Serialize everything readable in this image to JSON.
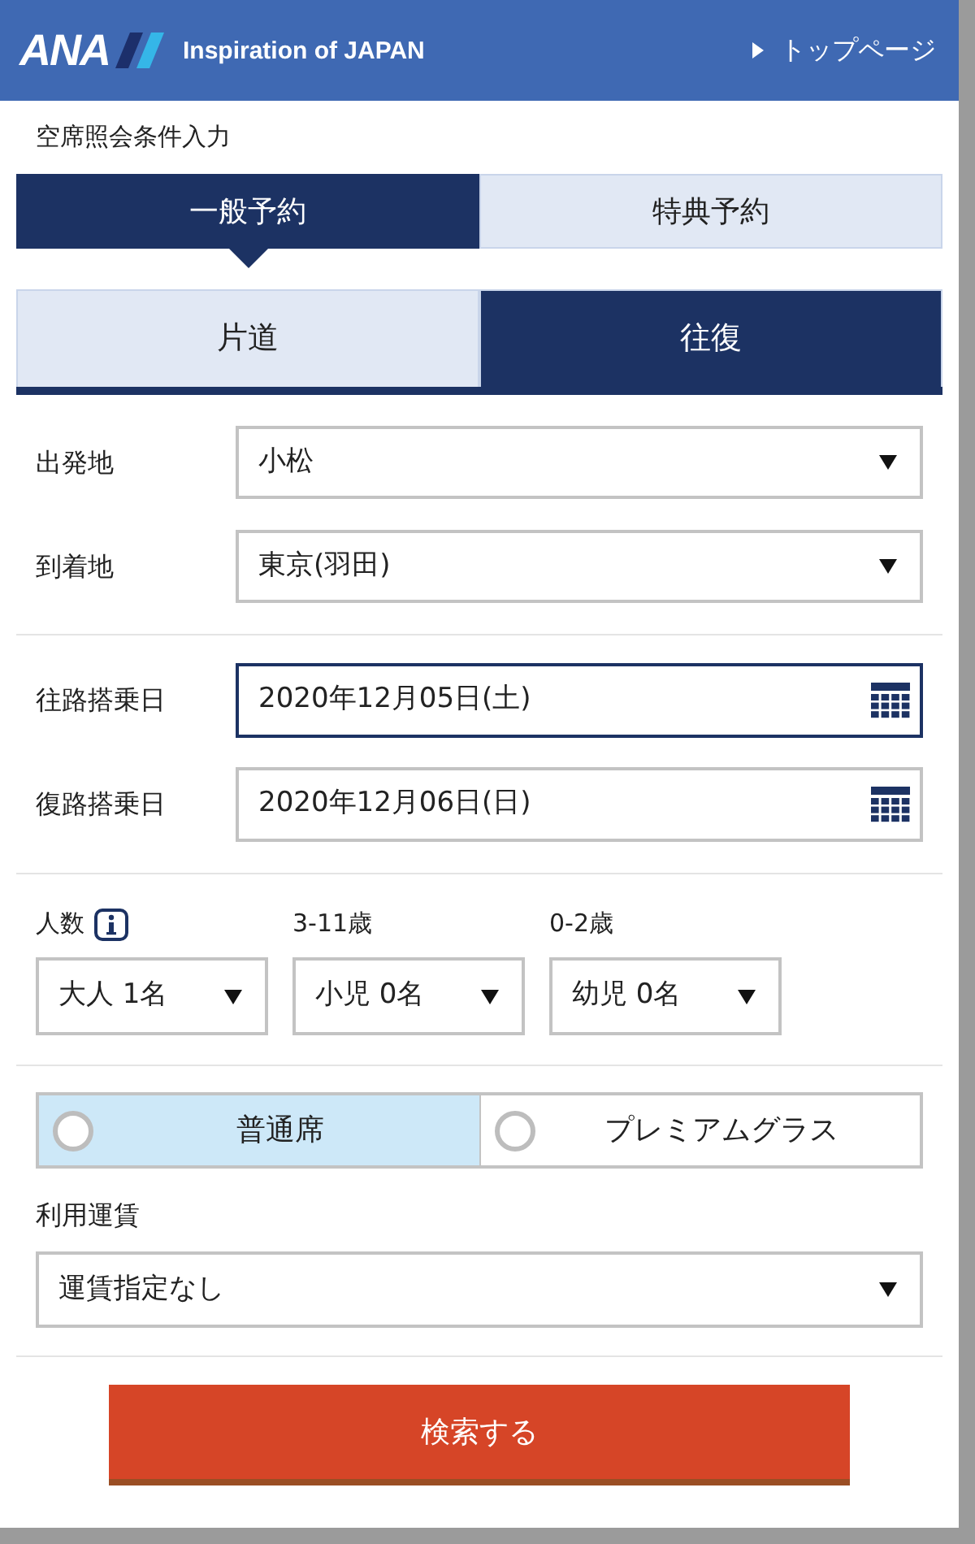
{
  "header": {
    "logo": "ANA",
    "tagline": "Inspiration of JAPAN",
    "top_link": "トップページ"
  },
  "title": "空席照会条件入力",
  "booking_tabs": [
    {
      "label": "一般予約",
      "selected": true
    },
    {
      "label": "特典予約",
      "selected": false
    }
  ],
  "trip_tabs": [
    {
      "label": "片道",
      "selected": false
    },
    {
      "label": "往復",
      "selected": true
    }
  ],
  "route_fields": [
    {
      "label": "出発地",
      "value": "小松"
    },
    {
      "label": "到着地",
      "value": "東京(羽田)"
    }
  ],
  "date_fields": [
    {
      "label": "往路搭乗日",
      "value": "2020年12月05日(土)",
      "focused": true
    },
    {
      "label": "復路搭乗日",
      "value": "2020年12月06日(日)",
      "focused": false
    }
  ],
  "passengers": {
    "label": "人数",
    "groups": [
      {
        "value": "大人 1名"
      },
      {
        "label": "3-11歳",
        "value": "小児 0名"
      },
      {
        "label": "0-2歳",
        "value": "幼児 0名"
      }
    ]
  },
  "seat_classes": [
    {
      "label": "普通席",
      "selected": true
    },
    {
      "label": "プレミアムグラス",
      "selected": false
    }
  ],
  "fare": {
    "label": "利用運賃",
    "value": "運賃指定なし"
  },
  "search_button": "検索する"
}
